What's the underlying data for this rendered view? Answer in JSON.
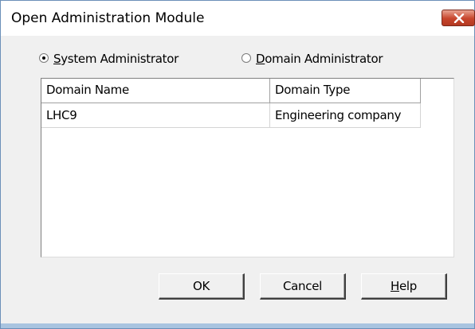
{
  "window": {
    "title": "Open Administration Module",
    "close_icon": "close-x-icon",
    "close_color": "#c7452c"
  },
  "role": {
    "options": [
      {
        "label_underline": "S",
        "label_rest": "ystem Administrator",
        "selected": true
      },
      {
        "label_underline": "D",
        "label_rest": "omain Administrator",
        "selected": false
      }
    ]
  },
  "domains": {
    "columns": [
      "Domain Name",
      "Domain Type"
    ],
    "rows": [
      [
        "LHC9",
        "Engineering company"
      ]
    ]
  },
  "buttons": {
    "ok": "OK",
    "cancel": "Cancel",
    "help_underline": "H",
    "help_rest": "elp"
  }
}
